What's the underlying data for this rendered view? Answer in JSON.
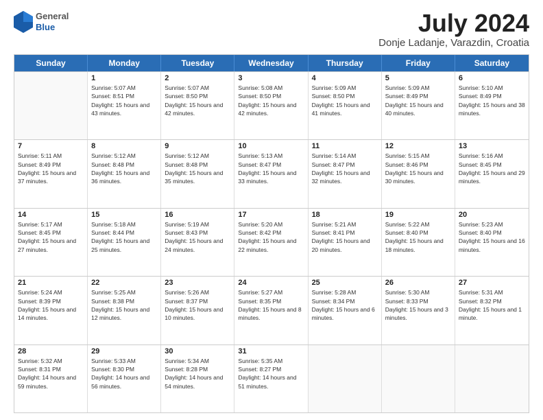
{
  "header": {
    "logo": {
      "general": "General",
      "blue": "Blue"
    },
    "title": "July 2024",
    "location": "Donje Ladanje, Varazdin, Croatia"
  },
  "calendar": {
    "days_of_week": [
      "Sunday",
      "Monday",
      "Tuesday",
      "Wednesday",
      "Thursday",
      "Friday",
      "Saturday"
    ],
    "rows": [
      [
        {
          "day": "",
          "sunrise": "",
          "sunset": "",
          "daylight": ""
        },
        {
          "day": "1",
          "sunrise": "Sunrise: 5:07 AM",
          "sunset": "Sunset: 8:51 PM",
          "daylight": "Daylight: 15 hours and 43 minutes."
        },
        {
          "day": "2",
          "sunrise": "Sunrise: 5:07 AM",
          "sunset": "Sunset: 8:50 PM",
          "daylight": "Daylight: 15 hours and 42 minutes."
        },
        {
          "day": "3",
          "sunrise": "Sunrise: 5:08 AM",
          "sunset": "Sunset: 8:50 PM",
          "daylight": "Daylight: 15 hours and 42 minutes."
        },
        {
          "day": "4",
          "sunrise": "Sunrise: 5:09 AM",
          "sunset": "Sunset: 8:50 PM",
          "daylight": "Daylight: 15 hours and 41 minutes."
        },
        {
          "day": "5",
          "sunrise": "Sunrise: 5:09 AM",
          "sunset": "Sunset: 8:49 PM",
          "daylight": "Daylight: 15 hours and 40 minutes."
        },
        {
          "day": "6",
          "sunrise": "Sunrise: 5:10 AM",
          "sunset": "Sunset: 8:49 PM",
          "daylight": "Daylight: 15 hours and 38 minutes."
        }
      ],
      [
        {
          "day": "7",
          "sunrise": "Sunrise: 5:11 AM",
          "sunset": "Sunset: 8:49 PM",
          "daylight": "Daylight: 15 hours and 37 minutes."
        },
        {
          "day": "8",
          "sunrise": "Sunrise: 5:12 AM",
          "sunset": "Sunset: 8:48 PM",
          "daylight": "Daylight: 15 hours and 36 minutes."
        },
        {
          "day": "9",
          "sunrise": "Sunrise: 5:12 AM",
          "sunset": "Sunset: 8:48 PM",
          "daylight": "Daylight: 15 hours and 35 minutes."
        },
        {
          "day": "10",
          "sunrise": "Sunrise: 5:13 AM",
          "sunset": "Sunset: 8:47 PM",
          "daylight": "Daylight: 15 hours and 33 minutes."
        },
        {
          "day": "11",
          "sunrise": "Sunrise: 5:14 AM",
          "sunset": "Sunset: 8:47 PM",
          "daylight": "Daylight: 15 hours and 32 minutes."
        },
        {
          "day": "12",
          "sunrise": "Sunrise: 5:15 AM",
          "sunset": "Sunset: 8:46 PM",
          "daylight": "Daylight: 15 hours and 30 minutes."
        },
        {
          "day": "13",
          "sunrise": "Sunrise: 5:16 AM",
          "sunset": "Sunset: 8:45 PM",
          "daylight": "Daylight: 15 hours and 29 minutes."
        }
      ],
      [
        {
          "day": "14",
          "sunrise": "Sunrise: 5:17 AM",
          "sunset": "Sunset: 8:45 PM",
          "daylight": "Daylight: 15 hours and 27 minutes."
        },
        {
          "day": "15",
          "sunrise": "Sunrise: 5:18 AM",
          "sunset": "Sunset: 8:44 PM",
          "daylight": "Daylight: 15 hours and 25 minutes."
        },
        {
          "day": "16",
          "sunrise": "Sunrise: 5:19 AM",
          "sunset": "Sunset: 8:43 PM",
          "daylight": "Daylight: 15 hours and 24 minutes."
        },
        {
          "day": "17",
          "sunrise": "Sunrise: 5:20 AM",
          "sunset": "Sunset: 8:42 PM",
          "daylight": "Daylight: 15 hours and 22 minutes."
        },
        {
          "day": "18",
          "sunrise": "Sunrise: 5:21 AM",
          "sunset": "Sunset: 8:41 PM",
          "daylight": "Daylight: 15 hours and 20 minutes."
        },
        {
          "day": "19",
          "sunrise": "Sunrise: 5:22 AM",
          "sunset": "Sunset: 8:40 PM",
          "daylight": "Daylight: 15 hours and 18 minutes."
        },
        {
          "day": "20",
          "sunrise": "Sunrise: 5:23 AM",
          "sunset": "Sunset: 8:40 PM",
          "daylight": "Daylight: 15 hours and 16 minutes."
        }
      ],
      [
        {
          "day": "21",
          "sunrise": "Sunrise: 5:24 AM",
          "sunset": "Sunset: 8:39 PM",
          "daylight": "Daylight: 15 hours and 14 minutes."
        },
        {
          "day": "22",
          "sunrise": "Sunrise: 5:25 AM",
          "sunset": "Sunset: 8:38 PM",
          "daylight": "Daylight: 15 hours and 12 minutes."
        },
        {
          "day": "23",
          "sunrise": "Sunrise: 5:26 AM",
          "sunset": "Sunset: 8:37 PM",
          "daylight": "Daylight: 15 hours and 10 minutes."
        },
        {
          "day": "24",
          "sunrise": "Sunrise: 5:27 AM",
          "sunset": "Sunset: 8:35 PM",
          "daylight": "Daylight: 15 hours and 8 minutes."
        },
        {
          "day": "25",
          "sunrise": "Sunrise: 5:28 AM",
          "sunset": "Sunset: 8:34 PM",
          "daylight": "Daylight: 15 hours and 6 minutes."
        },
        {
          "day": "26",
          "sunrise": "Sunrise: 5:30 AM",
          "sunset": "Sunset: 8:33 PM",
          "daylight": "Daylight: 15 hours and 3 minutes."
        },
        {
          "day": "27",
          "sunrise": "Sunrise: 5:31 AM",
          "sunset": "Sunset: 8:32 PM",
          "daylight": "Daylight: 15 hours and 1 minute."
        }
      ],
      [
        {
          "day": "28",
          "sunrise": "Sunrise: 5:32 AM",
          "sunset": "Sunset: 8:31 PM",
          "daylight": "Daylight: 14 hours and 59 minutes."
        },
        {
          "day": "29",
          "sunrise": "Sunrise: 5:33 AM",
          "sunset": "Sunset: 8:30 PM",
          "daylight": "Daylight: 14 hours and 56 minutes."
        },
        {
          "day": "30",
          "sunrise": "Sunrise: 5:34 AM",
          "sunset": "Sunset: 8:28 PM",
          "daylight": "Daylight: 14 hours and 54 minutes."
        },
        {
          "day": "31",
          "sunrise": "Sunrise: 5:35 AM",
          "sunset": "Sunset: 8:27 PM",
          "daylight": "Daylight: 14 hours and 51 minutes."
        },
        {
          "day": "",
          "sunrise": "",
          "sunset": "",
          "daylight": ""
        },
        {
          "day": "",
          "sunrise": "",
          "sunset": "",
          "daylight": ""
        },
        {
          "day": "",
          "sunrise": "",
          "sunset": "",
          "daylight": ""
        }
      ]
    ]
  }
}
